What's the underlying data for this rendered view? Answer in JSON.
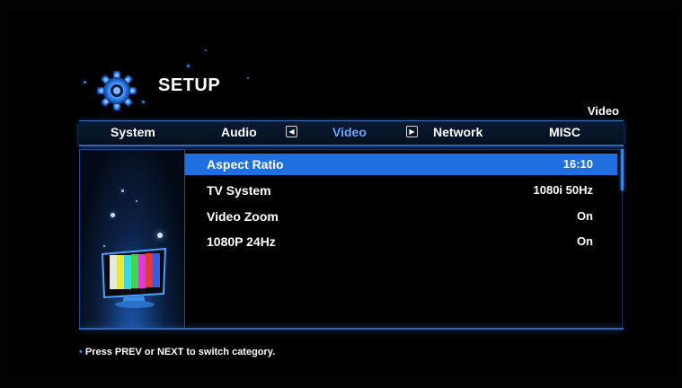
{
  "header": {
    "title": "SETUP",
    "current_category": "Video",
    "logo_icon": "gear-icon"
  },
  "tabs": [
    {
      "label": "System",
      "active": false
    },
    {
      "label": "Audio",
      "active": false
    },
    {
      "label": "Video",
      "active": true
    },
    {
      "label": "Network",
      "active": false
    },
    {
      "label": "MISC",
      "active": false
    }
  ],
  "tab_arrows": {
    "prev_icon": "arrow-left-icon",
    "next_icon": "arrow-right-icon"
  },
  "settings": [
    {
      "label": "Aspect Ratio",
      "value": "16:10",
      "selected": true
    },
    {
      "label": "TV System",
      "value": "1080i 50Hz",
      "selected": false
    },
    {
      "label": "Video Zoom",
      "value": "On",
      "selected": false
    },
    {
      "label": "1080P 24Hz",
      "value": "On",
      "selected": false
    }
  ],
  "footer": {
    "hint": "Press PREV or NEXT to switch category."
  },
  "colors": {
    "accent": "#1f6fe0",
    "active_tab": "#6aa6ff",
    "background": "#000000"
  },
  "panel_icon": "tv-icon"
}
